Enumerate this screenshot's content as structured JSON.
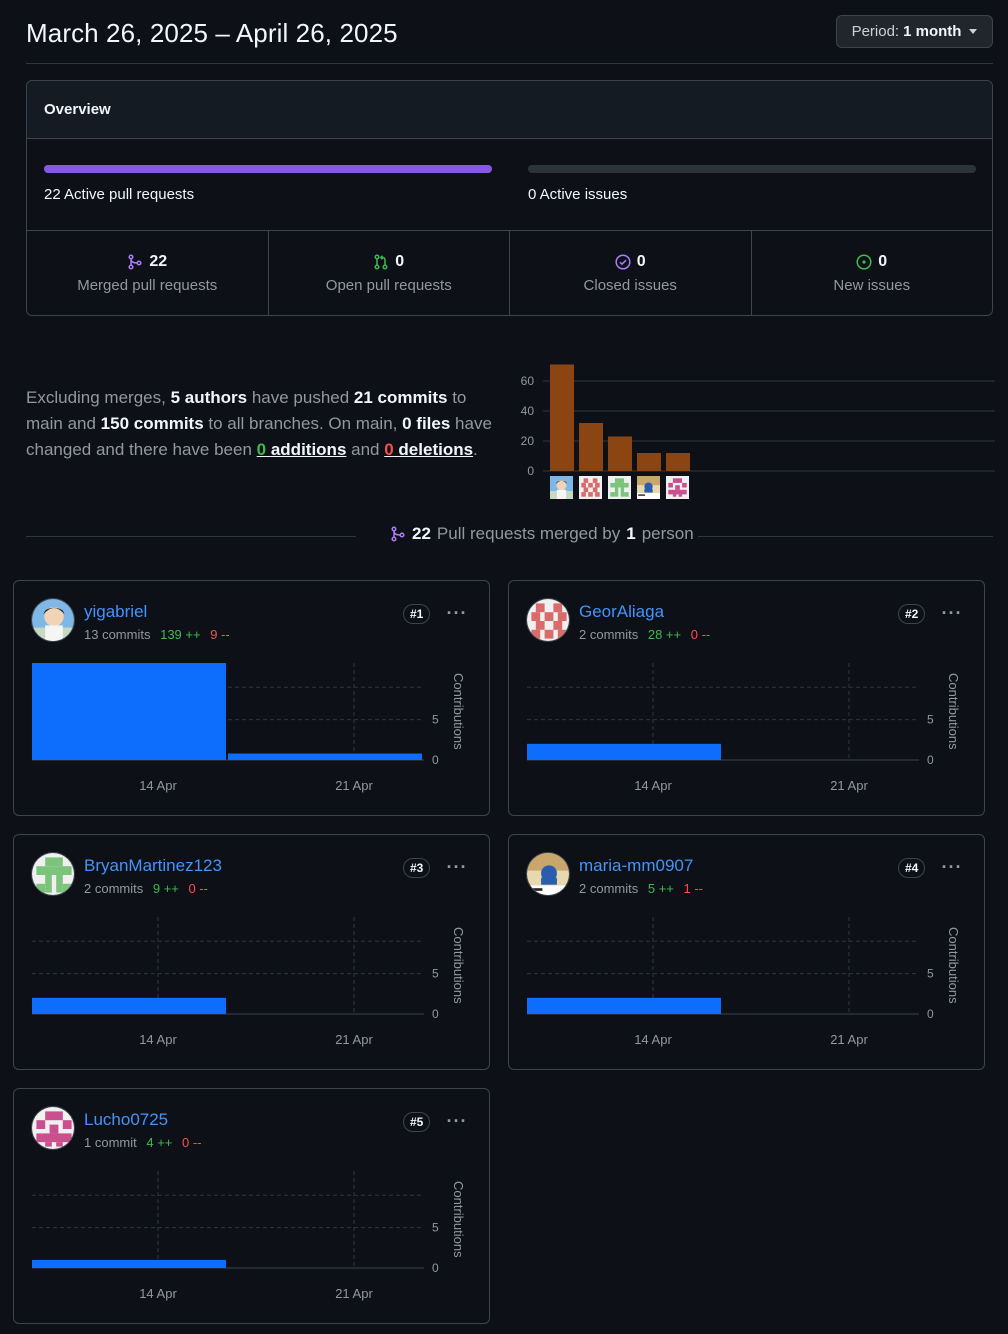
{
  "header": {
    "date_range": "March 26, 2025 – April 26, 2025",
    "period_prefix": "Period:",
    "period_value": "1 month"
  },
  "overview": {
    "title": "Overview",
    "active_prs_label": "22 Active pull requests",
    "active_prs_fill": 1.0,
    "active_issues_label": "0 Active issues",
    "active_issues_fill": 0,
    "stats": [
      {
        "icon": "git-merge-icon",
        "count": "22",
        "label": "Merged pull requests",
        "color": "#ab7df8"
      },
      {
        "icon": "git-pull-request-icon",
        "count": "0",
        "label": "Open pull requests",
        "color": "#3fb950"
      },
      {
        "icon": "issue-closed-icon",
        "count": "0",
        "label": "Closed issues",
        "color": "#ab7df8"
      },
      {
        "icon": "issue-opened-icon",
        "count": "0",
        "label": "New issues",
        "color": "#3fb950"
      }
    ]
  },
  "summary": {
    "t1": "Excluding merges, ",
    "authors": "5 authors",
    "t2": " have pushed ",
    "commits_main": "21 commits",
    "t3": " to main and ",
    "commits_all": "150 commits",
    "t4": " to all branches. On main, ",
    "files": "0 files",
    "t5": " have changed and there have been ",
    "additions_num": "0",
    "additions_word": "additions",
    "t6": " and ",
    "deletions_num": "0",
    "deletions_word": "deletions",
    "t7": "."
  },
  "chart_data": [
    {
      "type": "bar",
      "categories": [
        "yigabriel",
        "GeorAliaga",
        "BryanMartinez123",
        "maria-mm0907",
        "Lucho0725"
      ],
      "values": [
        71,
        32,
        23,
        12,
        12
      ],
      "yticks": [
        "0",
        "20",
        "40",
        "60"
      ],
      "ylim": [
        0,
        72
      ],
      "color": "#8b4513"
    }
  ],
  "merged": {
    "count": "22",
    "t1": "Pull requests merged by",
    "persons": "1",
    "t2": "person"
  },
  "contributors": [
    {
      "name": "yigabriel",
      "commits": "13 commits",
      "additions": "139 ++",
      "deletions": "9 --",
      "rank": "#1",
      "bars": [
        12,
        0.8
      ],
      "avatar": "photo"
    },
    {
      "name": "GeorAliaga",
      "commits": "2 commits",
      "additions": "28 ++",
      "deletions": "0 --",
      "rank": "#2",
      "bars": [
        2,
        0
      ],
      "avatar": "red"
    },
    {
      "name": "BryanMartinez123",
      "commits": "2 commits",
      "additions": "9 ++",
      "deletions": "0 --",
      "rank": "#3",
      "bars": [
        2,
        0
      ],
      "avatar": "green"
    },
    {
      "name": "maria-mm0907",
      "commits": "2 commits",
      "additions": "5 ++",
      "deletions": "1 --",
      "rank": "#4",
      "bars": [
        2,
        0
      ],
      "avatar": "photo2"
    },
    {
      "name": "Lucho0725",
      "commits": "1 commit",
      "additions": "4 ++",
      "deletions": "0 --",
      "rank": "#5",
      "bars": [
        1,
        0
      ],
      "avatar": "pink"
    }
  ],
  "contrib_chart": {
    "xticks": [
      "14 Apr",
      "21 Apr"
    ],
    "yticks": [
      "0",
      "5"
    ],
    "ylabel": "Contributions",
    "ylim": [
      0,
      12
    ],
    "color": "#1f6feb"
  },
  "colors": {
    "accent_purple": "#8957e5",
    "bar_blue": "#0d6efd",
    "bar_brown": "#8b4513"
  }
}
